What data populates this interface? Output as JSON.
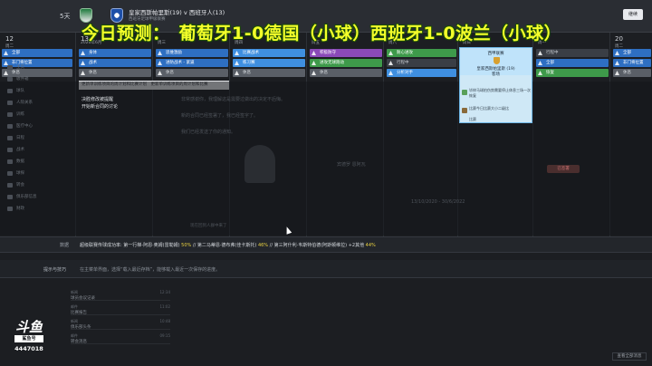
{
  "topbar": {
    "days": "5天",
    "fixture": "皇家西斯帕里斯(19) v 西班牙人(13)",
    "fixture_sub": "西班牙足球甲级联赛",
    "continue": "继续"
  },
  "overlay": {
    "prediction": "今日预测：　葡萄牙1-0德国（小球）西班牙1-0波兰（小球）"
  },
  "calendar": {
    "days": [
      {
        "num": "12",
        "name": "周二"
      },
      {
        "num": "13",
        "name": "2020年6月"
      },
      {
        "num": "",
        "name": "周三"
      },
      {
        "num": "",
        "name": "周四"
      },
      {
        "num": "",
        "name": "周五"
      },
      {
        "num": "",
        "name": "周六"
      },
      {
        "num": "",
        "name": "周日"
      },
      {
        "num": "",
        "name": "周一"
      },
      {
        "num": "20",
        "name": "周二"
      }
    ],
    "col0": [
      "全部",
      "非门将位置",
      "休息"
    ],
    "col1": [
      "身体",
      "战术",
      "休息"
    ],
    "col2": [
      "思维激励",
      "进防战术 - 紧逼",
      "休息"
    ],
    "col3": [
      "比赛战术",
      "练习赛",
      "休息"
    ],
    "col4": [
      "积极防守",
      "进攻无球跑动",
      "休息"
    ],
    "col5": [
      "耐心进攻",
      "行程中",
      "分析对手"
    ],
    "col7": [
      "行程中",
      "全部",
      "恢复"
    ],
    "col8": [
      "全部",
      "非门将位置",
      "休息"
    ],
    "popup": [
      "更新单训练项目的周计划和比赛计划",
      "更新单训练项目的周计划和比赛"
    ],
    "reminder_title": "决胜修改被提醒",
    "reminder_sub": "开始新合同的讨论"
  },
  "match_card": {
    "title": "西甲联赛",
    "teams": "皇家西斯帕里斯 (19)",
    "venue": "客场",
    "note1": "毕梓马球拍伤势需要停止休息三场一次恢复",
    "note2": "比赛今日比赛大小二级比",
    "note2b": "比赛"
  },
  "background_text": {
    "line1": "非常感谢你，我理解这是需要过做出的决定不后悔。",
    "line2": "新的合同已经签署了，我已经签字了。",
    "line3": "我们已经发送了你的通知。",
    "line4": "现在回到人群中来了",
    "name": "宾德罗 恩阿瓦",
    "contract": "13/10/2020 - 30/6/2022",
    "status": "已签署",
    "bottom_link": "查看所有合同"
  },
  "info": {
    "label": "数据",
    "text": "超级联赛传球成功率: 第一行梯-阿恩·奥姆(雷勒姆) 50% // 第二马蒂恩·德布弗(佳卡斯托) 46% // 第三阿什利·韦斯特伯德(阿斯顿维拉) +2其他 44%",
    "highlights": [
      "50%",
      "46%",
      "44%"
    ]
  },
  "tips": {
    "label": "提示与技巧",
    "text": "在主菜单界面，选择“载入最近存档”，能够载入最近一次保存的进度。"
  },
  "sidebar": [
    "主页",
    "收件箱",
    "球队",
    "人际关系",
    "训练",
    "医疗中心",
    "日程",
    "战术",
    "数据",
    "球探",
    "转会",
    "俱乐部信息",
    "财政"
  ],
  "news": [
    {
      "a": "新闻",
      "b": "球员会议记录",
      "d": "12:34"
    },
    {
      "a": "邮件",
      "b": "比赛报告",
      "d": "11:02"
    },
    {
      "a": "新闻",
      "b": "俱乐部头条",
      "d": "10:48"
    },
    {
      "a": "邮件",
      "b": "转会消息",
      "d": "09:15"
    }
  ],
  "logo": {
    "big": "斗鱼",
    "tag": "鲨鱼号",
    "num": "4447018"
  },
  "bottom_right": "查看全部消息"
}
